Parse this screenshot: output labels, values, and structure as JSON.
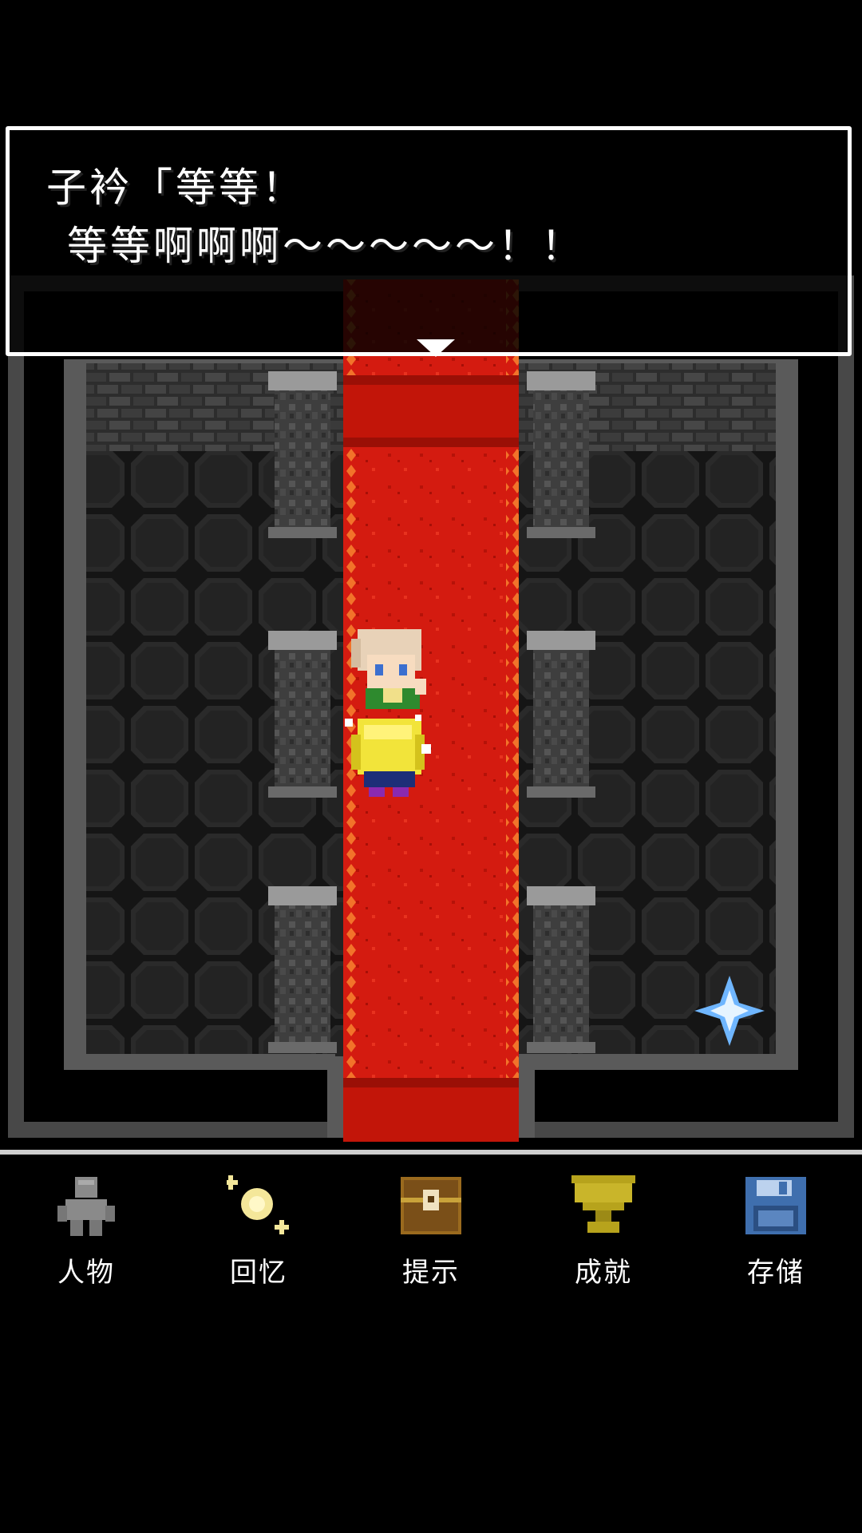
{
  "dialogue": {
    "line1": "子衿「等等！",
    "line2": "等等啊啊啊～～～～～！！"
  },
  "menu": [
    {
      "key": "character",
      "label": "人物",
      "icon": "person-icon"
    },
    {
      "key": "memory",
      "label": "回忆",
      "icon": "sparkle-orb-icon"
    },
    {
      "key": "hint",
      "label": "提示",
      "icon": "treasure-chest-icon"
    },
    {
      "key": "achievement",
      "label": "成就",
      "icon": "trophy-icon"
    },
    {
      "key": "save",
      "label": "存储",
      "icon": "floppy-disk-icon"
    }
  ],
  "colors": {
    "carpet": "#d41b10",
    "carpet_border": "#f2732a",
    "floor": "#1e1e1e",
    "wall": "#3a3a3a",
    "menu_divider": "#cfcfcf",
    "crystal": "#6fb6ff"
  }
}
